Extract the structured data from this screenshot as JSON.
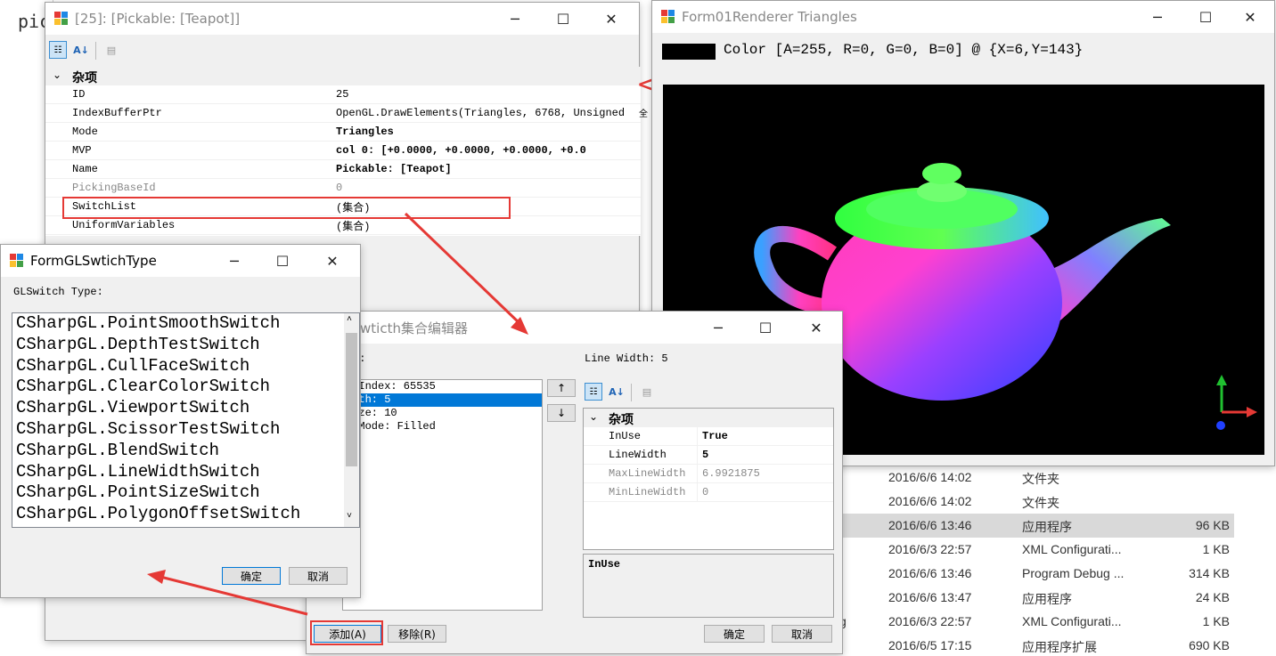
{
  "bg_window": {
    "label": "pic"
  },
  "property_window": {
    "title": "[25]: [Pickable: [Teapot]]",
    "category": "杂项",
    "rows": [
      {
        "key": "ID",
        "value": "25",
        "bold": false,
        "gray": false
      },
      {
        "key": "IndexBufferPtr",
        "value": "OpenGL.DrawElements(Triangles, 6768, Unsigned",
        "suffix": "全",
        "bold": false,
        "gray": false
      },
      {
        "key": "Mode",
        "value": "Triangles",
        "bold": true,
        "gray": false
      },
      {
        "key": "MVP",
        "value": "col 0: [+0.0000, +0.0000, +0.0000, +0.0",
        "bold": true,
        "gray": false
      },
      {
        "key": "Name",
        "value": "Pickable: [Teapot]",
        "bold": true,
        "gray": false
      },
      {
        "key": "PickingBaseId",
        "value": "0",
        "bold": false,
        "gray": true
      },
      {
        "key": "SwitchList",
        "value": "(集合)",
        "bold": false,
        "gray": false
      },
      {
        "key": "UniformVariables",
        "value": "(集合)",
        "bold": false,
        "gray": false
      }
    ]
  },
  "renderer_window": {
    "title": "Form01Renderer Triangles",
    "color_text": "Color [A=255, R=0, G=0, B=0] @ {X=6,Y=143}",
    "swatch_color": "#000000"
  },
  "switch_type_window": {
    "title": "FormGLSwtichType",
    "label": "GLSwitch Type:",
    "items": [
      "CSharpGL.PointSmoothSwitch",
      "CSharpGL.DepthTestSwitch",
      "CSharpGL.CullFaceSwitch",
      "CSharpGL.ClearColorSwitch",
      "CSharpGL.ViewportSwitch",
      "CSharpGL.ScissorTestSwitch",
      "CSharpGL.BlendSwitch",
      "CSharpGL.LineWidthSwitch",
      "CSharpGL.PointSizeSwitch",
      "CSharpGL.PolygonOffsetSwitch"
    ],
    "ok": "确定",
    "cancel": "取消"
  },
  "collection_editor": {
    "title": "wticth集合编辑器",
    "members_label": "):",
    "props_label": "Line Width: 5",
    "members": [
      {
        "text": "t Index: 65535",
        "selected": false
      },
      {
        "text": "idth: 5",
        "selected": true
      },
      {
        "text": " Size: 10",
        "selected": false
      },
      {
        "text": "n Mode: Filled",
        "selected": false
      }
    ],
    "up_arrow": "↑",
    "down_arrow": "↓",
    "category": "杂项",
    "props": [
      {
        "key": "InUse",
        "value": "True",
        "bold": true,
        "gray": false
      },
      {
        "key": "LineWidth",
        "value": "5",
        "bold": true,
        "gray": false
      },
      {
        "key": "MaxLineWidth",
        "value": "6.9921875",
        "bold": false,
        "gray": true
      },
      {
        "key": "MinLineWidth",
        "value": "0",
        "bold": false,
        "gray": true
      }
    ],
    "description": "InUse",
    "add": "添加(A)",
    "remove": "移除(R)",
    "ok": "确定",
    "cancel": "取消"
  },
  "file_list": [
    {
      "date": "2016/6/6 14:02",
      "type": "文件夹",
      "size": "",
      "selected": false,
      "prefix": ""
    },
    {
      "date": "2016/6/6 14:02",
      "type": "文件夹",
      "size": "",
      "selected": false,
      "prefix": ""
    },
    {
      "date": "2016/6/6 13:46",
      "type": "应用程序",
      "size": "96 KB",
      "selected": true,
      "prefix": ""
    },
    {
      "date": "2016/6/3 22:57",
      "type": "XML Configurati...",
      "size": "1 KB",
      "selected": false,
      "prefix": ""
    },
    {
      "date": "2016/6/6 13:46",
      "type": "Program Debug ...",
      "size": "314 KB",
      "selected": false,
      "prefix": ""
    },
    {
      "date": "2016/6/6 13:47",
      "type": "应用程序",
      "size": "24 KB",
      "selected": false,
      "prefix": ""
    },
    {
      "date": "2016/6/3 22:57",
      "type": "XML Configurati...",
      "size": "1 KB",
      "selected": false,
      "prefix": "g"
    },
    {
      "date": "2016/6/5 17:15",
      "type": "应用程序扩展",
      "size": "690 KB",
      "selected": false,
      "prefix": ""
    }
  ],
  "colors": {
    "annotation_red": "#e53935",
    "selection_blue": "#0078d7"
  }
}
